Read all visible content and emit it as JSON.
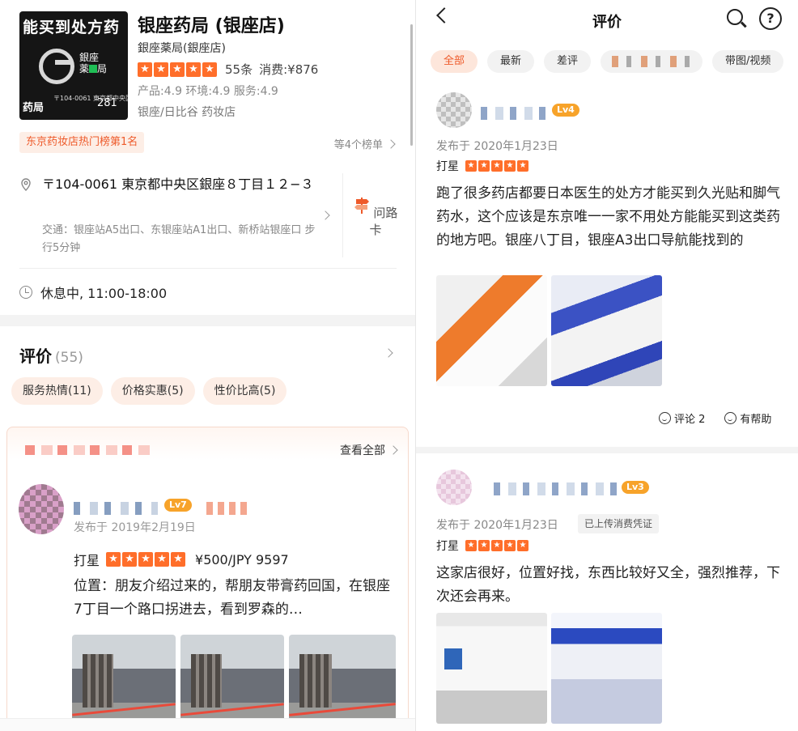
{
  "shop": {
    "logo": {
      "top_text": "能买到处方药",
      "name_line1": "銀座",
      "name_line2": "薬",
      "name_line3": "局",
      "bottom_text": "药局",
      "address_small": "〒104-0061 東京都中央区",
      "number": "281"
    },
    "title": "银座药局 (银座店)",
    "subtitle": "銀座薬局(銀座店)",
    "review_count": "55条",
    "consume": "消费:¥876",
    "scores": "产品:4.9 环境:4.9 服务:4.9",
    "area": "银座/日比谷   药妆店",
    "rank_tag": "东京药妆店热门榜第1名",
    "rank_more": "等4个榜单",
    "address": "〒104-0061 東京都中央区銀座８丁目１２−３",
    "traffic": "交通：银座站A5出口、东银座站A1出口、新桥站银座口 步行5分钟",
    "route_label": "问路卡",
    "hours": "休息中, 11:00-18:00"
  },
  "reviews_section": {
    "title": "评价",
    "count": "(55)",
    "tags": [
      "服务热情(11)",
      "价格实惠(5)",
      "性价比高(5)"
    ],
    "view_all": "查看全部",
    "featured": {
      "level": "Lv7",
      "posted": "发布于 2019年2月19日",
      "rating_label": "打星",
      "price": "¥500/JPY 9597",
      "text": "位置：朋友介绍过来的，帮朋友带膏药回国，在银座7丁目一个路口拐进去，看到罗森的…"
    }
  },
  "right_panel": {
    "nav_title": "评价",
    "filters": [
      "全部",
      "最新",
      "差评",
      "",
      "带图/视频"
    ],
    "reviews": [
      {
        "level": "Lv4",
        "posted": "发布于 2020年1月23日",
        "rating_label": "打星",
        "text": "跑了很多药店都要日本医生的处方才能买到久光贴和脚气药水，这个应该是东京唯一一家不用处方能能买到这类药的地方吧。银座八丁目，银座A3出口导航能找到的",
        "comment": "评论 2",
        "helpful": "有帮助"
      },
      {
        "level": "Lv3",
        "posted": "发布于 2020年1月23日",
        "voucher": "已上传消费凭证",
        "rating_label": "打星",
        "text": "这家店很好，位置好找，东西比较好又全，强烈推荐，下次还会再来。"
      }
    ]
  },
  "colors": {
    "accent": "#ff6e2a",
    "tag_bg": "#fdeee6",
    "level_badge": "#f7a32a"
  }
}
